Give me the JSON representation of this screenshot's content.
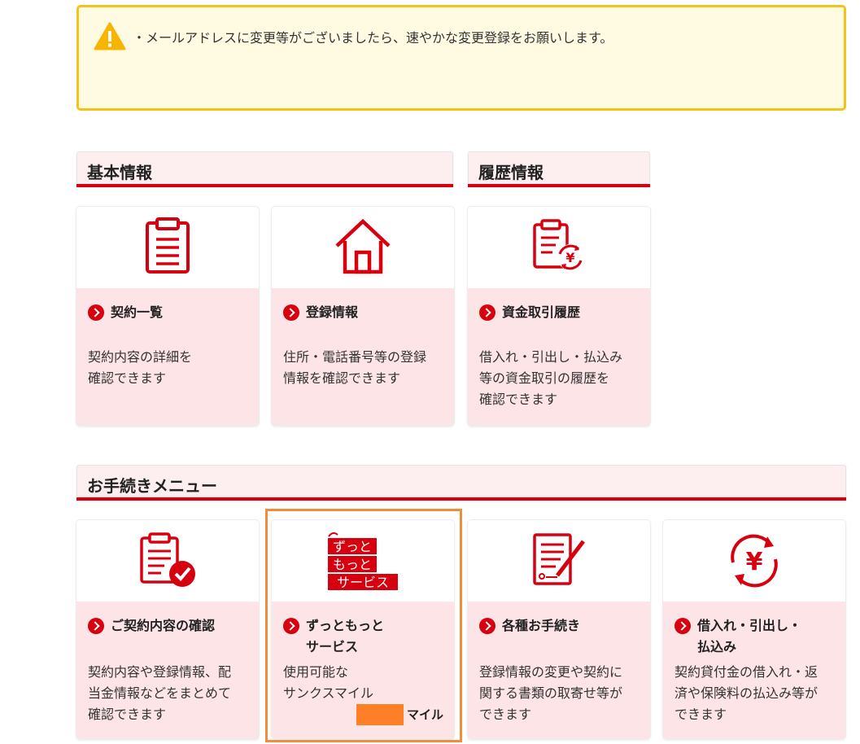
{
  "notice": {
    "icon": "warning-icon",
    "message": "・メールアドレスに変更等がございましたら、速やかな変更登録をお願いします。"
  },
  "sections": {
    "basic": "基本情報",
    "history": "履歴情報",
    "procedures": "お手続きメニュー"
  },
  "cards": {
    "contract_list": {
      "title": "契約一覧",
      "desc": [
        "契約内容の詳細を",
        "確認できます"
      ],
      "icon": "clipboard-icon"
    },
    "registration": {
      "title": "登録情報",
      "desc": [
        "住所・電話番号等の登録",
        "情報を確認できます"
      ],
      "icon": "house-icon"
    },
    "transactions": {
      "title": "資金取引履歴",
      "desc": [
        "借入れ・引出し・払込み",
        "等の資金取引の履歴を",
        "確認できます"
      ],
      "icon": "yen-document-icon"
    },
    "contract_confirm": {
      "title": "ご契約内容の確認",
      "desc": [
        "契約内容や登録情報、配",
        "当金情報などをまとめて",
        "確認できます"
      ],
      "icon": "clipboard-check-icon"
    },
    "zutto": {
      "title_line1": "ずっともっと",
      "title_line2": "サービス",
      "desc": [
        "使用可能な",
        "サンクスマイル"
      ],
      "logo_text": [
        "ずっと",
        "もっと",
        "サービス"
      ],
      "mile_unit": "マイル",
      "icon": "zutto-motto-logo"
    },
    "procedures": {
      "title": "各種お手続き",
      "desc": [
        "登録情報の変更や契約に",
        "関する書類の取寄せ等が",
        "できます"
      ],
      "icon": "document-pen-icon"
    },
    "loans": {
      "title_line1": "借入れ・引出し・",
      "title_line2": "払込み",
      "desc": [
        "契約貸付金の借入れ・返",
        "済や保険料の払込み等が",
        "できます"
      ],
      "icon": "yen-cycle-icon"
    }
  },
  "colors": {
    "accent": "#d6000f",
    "card_bg": "#fde4e6",
    "notice_border": "#f0c419",
    "highlight": "#f08c3a",
    "mile_box": "#ff7f27"
  }
}
